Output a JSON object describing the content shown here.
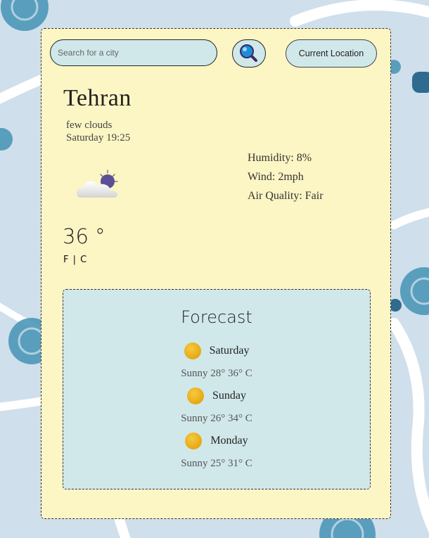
{
  "search": {
    "placeholder": "Search for a city"
  },
  "buttons": {
    "current_location": "Current Location"
  },
  "icons": {
    "search": "magnifier-icon",
    "weather": "cloud-sun-icon",
    "forecast": "sun-icon"
  },
  "weather": {
    "city": "Tehran",
    "description": "few clouds",
    "datetime": "Saturday 19:25",
    "humidity": "Humidity: 8%",
    "wind": "Wind: 2mph",
    "air_quality": "Air Quality: Fair",
    "temperature": "36 °",
    "unit_f": "F",
    "unit_sep": " | ",
    "unit_c": "C"
  },
  "forecast": {
    "title": "Forecast",
    "days": [
      {
        "day": "Saturday",
        "detail": "Sunny 28° 36° C"
      },
      {
        "day": "Sunday",
        "detail": "Sunny 26° 34° C"
      },
      {
        "day": "Monday",
        "detail": "Sunny 25° 31° C"
      }
    ]
  },
  "colors": {
    "background": "#cfdfeb",
    "card": "#fcf5c4",
    "panel": "#d1e8ea",
    "brush": "#4b97b8",
    "sun": "#e6a814"
  }
}
